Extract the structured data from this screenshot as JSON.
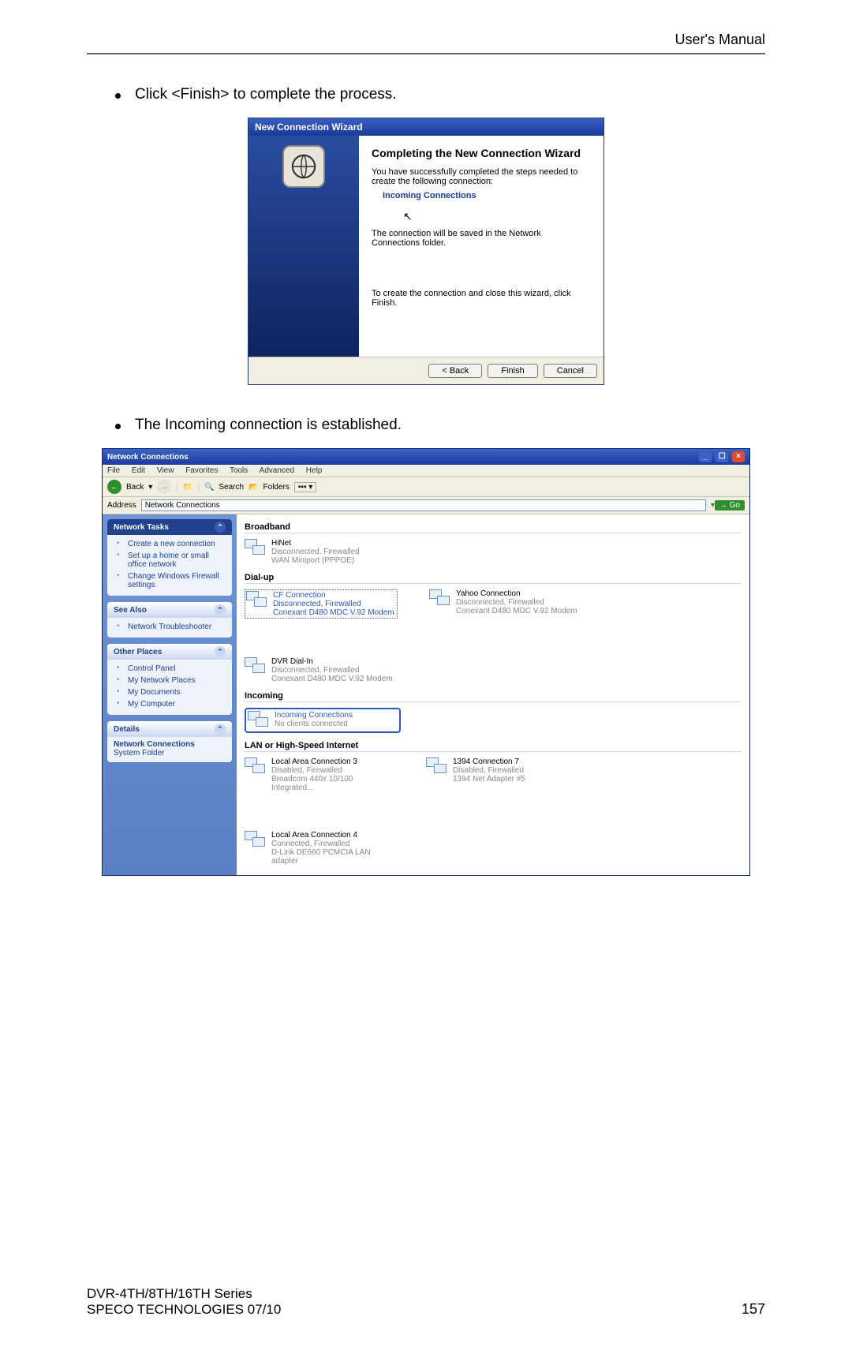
{
  "header": "User's Manual",
  "bullet1": "Click <Finish> to complete the process.",
  "bullet2": "The Incoming connection is established.",
  "wizard": {
    "title": "New Connection Wizard",
    "heading": "Completing the New Connection Wizard",
    "line1": "You have successfully completed the steps needed to create the following connection:",
    "conn_name": "Incoming Connections",
    "line2": "The connection will be saved in the Network Connections folder.",
    "line3": "To create the connection and close this wizard, click Finish.",
    "back": "< Back",
    "finish": "Finish",
    "cancel": "Cancel"
  },
  "nc": {
    "title": "Network Connections",
    "menu": [
      "File",
      "Edit",
      "View",
      "Favorites",
      "Tools",
      "Advanced",
      "Help"
    ],
    "toolbar": {
      "back": "Back",
      "search": "Search",
      "folders": "Folders"
    },
    "address_label": "Address",
    "address_value": "Network Connections",
    "go": "Go",
    "side": {
      "tasks_head": "Network Tasks",
      "tasks": [
        "Create a new connection",
        "Set up a home or small office network",
        "Change Windows Firewall settings"
      ],
      "see_head": "See Also",
      "see": [
        "Network Troubleshooter"
      ],
      "other_head": "Other Places",
      "other": [
        "Control Panel",
        "My Network Places",
        "My Documents",
        "My Computer"
      ],
      "details_head": "Details",
      "details_line1": "Network Connections",
      "details_line2": "System Folder"
    },
    "cats": {
      "broadband": "Broadband",
      "dialup": "Dial-up",
      "incoming": "Incoming",
      "lan": "LAN or High-Speed Internet"
    },
    "items": {
      "hinet": {
        "t1": "HiNet",
        "t2": "Disconnected, Firewalled",
        "t3": "WAN Miniport (PPPOE)"
      },
      "cf": {
        "t1": "CF Connection",
        "t2": "Disconnected, Firewalled",
        "t3": "Conexant D480 MDC V.92 Modem"
      },
      "yahoo": {
        "t1": "Yahoo Connection",
        "t2": "Disconnected, Firewalled",
        "t3": "Conexant D480 MDC V.92 Modem"
      },
      "dvr": {
        "t1": "DVR Dial-In",
        "t2": "Disconnected, Firewalled",
        "t3": "Conexant D480 MDC V.92 Modem"
      },
      "inc": {
        "t1": "Incoming Connections",
        "t2": "No clients connected",
        "t3": ""
      },
      "lac3": {
        "t1": "Local Area Connection 3",
        "t2": "Disabled, Firewalled",
        "t3": "Broadcom 440x 10/100 Integrated..."
      },
      "c1394": {
        "t1": "1394 Connection 7",
        "t2": "Disabled, Firewalled",
        "t3": "1394 Net Adapter #5"
      },
      "lac4": {
        "t1": "Local Area Connection 4",
        "t2": "Connected, Firewalled",
        "t3": "D-Link DE660 PCMCIA LAN adapter"
      }
    }
  },
  "footer": {
    "l1": "DVR-4TH/8TH/16TH Series",
    "l2": "SPECO TECHNOLOGIES 07/10",
    "page": "157"
  }
}
